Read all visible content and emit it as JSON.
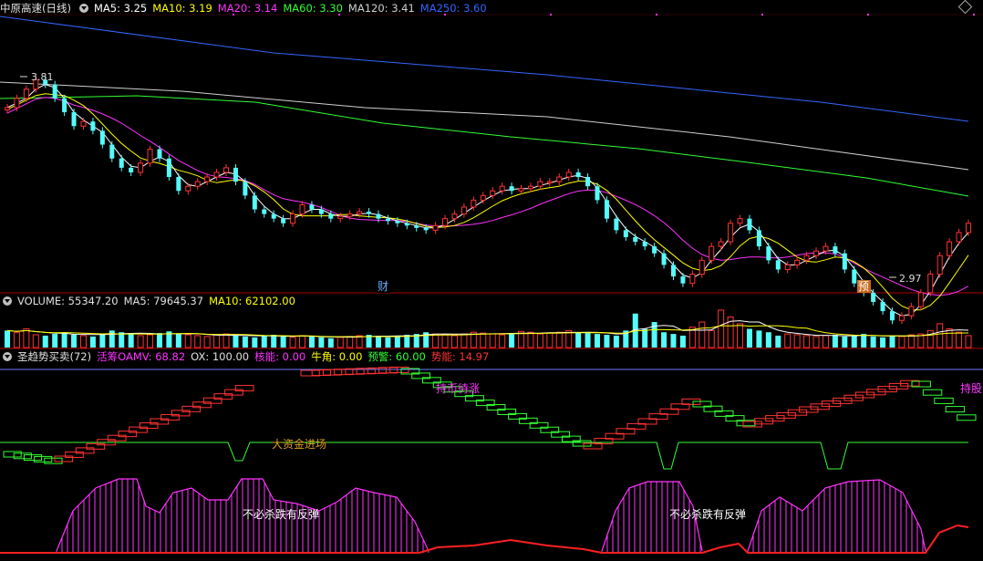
{
  "header": {
    "title": "中原高速(日线)",
    "ma_labels": [
      {
        "text": "MA5: 3.25",
        "color": "#ffffff"
      },
      {
        "text": "MA10: 3.19",
        "color": "#ffff00"
      },
      {
        "text": "MA20: 3.14",
        "color": "#ff33ff"
      },
      {
        "text": "MA60: 3.30",
        "color": "#33ff33"
      },
      {
        "text": "MA120: 3.41",
        "color": "#d0d0d0"
      },
      {
        "text": "MA250: 3.60",
        "color": "#3366ff"
      }
    ]
  },
  "volume_header": [
    {
      "text": "VOLUME: 55347.20",
      "color": "#e0e0e0"
    },
    {
      "text": "MA5: 79645.37",
      "color": "#e0e0e0"
    },
    {
      "text": "MA10: 62102.00",
      "color": "#ffff00"
    }
  ],
  "indicator_header": [
    {
      "text": "圣趋势买卖(72)",
      "color": "#e0e0e0"
    },
    {
      "text": "活筹OAMV: 68.82",
      "color": "#ff33ff"
    },
    {
      "text": "OX: 100.00",
      "color": "#e0e0e0"
    },
    {
      "text": "核能: 0.00",
      "color": "#ff33ff"
    },
    {
      "text": "牛角: 0.00",
      "color": "#ffff00"
    },
    {
      "text": "预警: 60.00",
      "color": "#33ff33"
    },
    {
      "text": "势能: 14.97",
      "color": "#ff3333"
    }
  ],
  "annotations": {
    "high_label": "3.81",
    "low_label": "2.97",
    "cai": "财",
    "yu": "预",
    "chi_bi": "持币待涨",
    "chi_gu": "持股",
    "da_zijin": "大资金进场",
    "bubi_1": "不必杀跌有反弹",
    "bubi_2": "不必杀跌有反弹"
  },
  "colors": {
    "up": "#ff3333",
    "down": "#54fcfc",
    "ma5": "#ffffff",
    "ma10": "#ffff00",
    "ma20": "#ff33ff",
    "ma60": "#33ff33",
    "ma120": "#d0d0d0",
    "ma250": "#3366ff",
    "divider": "#b00000"
  },
  "chart_data": {
    "type": "candlestick",
    "price_range": [
      2.97,
      3.81
    ],
    "price_path": [
      3.68,
      3.72,
      3.76,
      3.8,
      3.78,
      3.72,
      3.66,
      3.6,
      3.62,
      3.58,
      3.52,
      3.46,
      3.42,
      3.4,
      3.44,
      3.5,
      3.46,
      3.38,
      3.32,
      3.34,
      3.36,
      3.38,
      3.4,
      3.42,
      3.36,
      3.3,
      3.24,
      3.22,
      3.2,
      3.18,
      3.22,
      3.26,
      3.24,
      3.22,
      3.2,
      3.21,
      3.22,
      3.23,
      3.22,
      3.2,
      3.19,
      3.18,
      3.17,
      3.16,
      3.15,
      3.17,
      3.2,
      3.22,
      3.25,
      3.28,
      3.3,
      3.32,
      3.34,
      3.32,
      3.33,
      3.34,
      3.36,
      3.36,
      3.38,
      3.4,
      3.38,
      3.34,
      3.28,
      3.2,
      3.15,
      3.12,
      3.1,
      3.08,
      3.05,
      3.0,
      2.95,
      2.92,
      2.96,
      3.02,
      3.08,
      3.1,
      3.18,
      3.2,
      3.15,
      3.08,
      3.02,
      2.98,
      3.0,
      3.02,
      3.04,
      3.06,
      3.08,
      3.05,
      2.98,
      2.92,
      2.88,
      2.84,
      2.8,
      2.76,
      2.78,
      2.82,
      2.88,
      2.96,
      3.04,
      3.1,
      3.14,
      3.18
    ],
    "ma_final": {
      "MA5": 3.25,
      "MA10": 3.19,
      "MA20": 3.14,
      "MA60": 3.3,
      "MA120": 3.41,
      "MA250": 3.6
    },
    "volume_path": [
      20,
      18,
      22,
      15,
      14,
      16,
      18,
      15,
      14,
      13,
      16,
      20,
      18,
      16,
      14,
      15,
      17,
      19,
      16,
      15,
      14,
      13,
      15,
      16,
      14,
      13,
      12,
      14,
      15,
      13,
      12,
      14,
      13,
      12,
      11,
      12,
      13,
      14,
      15,
      13,
      12,
      14,
      15,
      16,
      18,
      16,
      15,
      14,
      16,
      18,
      17,
      16,
      15,
      17,
      19,
      18,
      16,
      17,
      18,
      20,
      18,
      17,
      16,
      15,
      14,
      20,
      40,
      22,
      30,
      18,
      16,
      14,
      24,
      30,
      20,
      44,
      36,
      28,
      22,
      20,
      18,
      14,
      16,
      15,
      14,
      13,
      14,
      15,
      13,
      14,
      16,
      13,
      12,
      14,
      13,
      15,
      16,
      20,
      28,
      22,
      18,
      14
    ],
    "volume_ma": {
      "MA5": 79645.37,
      "MA10": 62102.0
    },
    "indicator": {
      "OAMV": 68.82,
      "OX": 100.0,
      "核能": 0.0,
      "牛角": 0.0,
      "预警": 60.0,
      "势能": 14.97
    }
  }
}
